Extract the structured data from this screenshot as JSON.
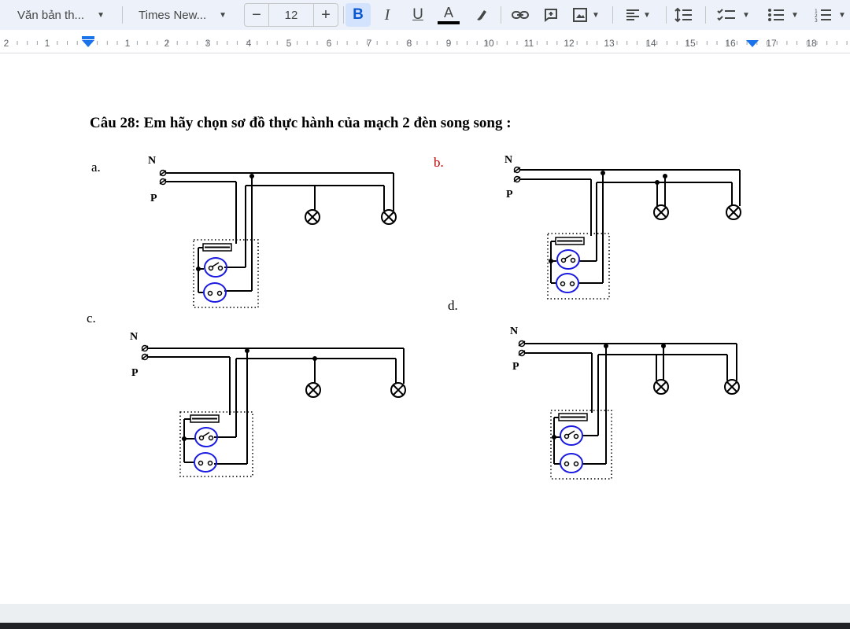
{
  "toolbar": {
    "style_select": "Văn bản th...",
    "font_select": "Times New...",
    "font_size": "12",
    "minus": "−",
    "plus": "+",
    "bold": "B",
    "italic": "I",
    "underline": "U",
    "text_color": "A",
    "text_color_value": "#000000"
  },
  "ruler": {
    "labels": [
      "2",
      "1",
      "1",
      "2",
      "3",
      "4",
      "5",
      "6",
      "7",
      "8",
      "9",
      "10",
      "11",
      "12",
      "13",
      "14",
      "15",
      "16",
      "17",
      "18"
    ],
    "marker_color": "#1a73e8"
  },
  "document": {
    "question": "Câu 28: Em hãy chọn sơ đồ thực hành của mạch 2 đèn  song song :",
    "options": [
      {
        "label": "a.",
        "color": "#000000"
      },
      {
        "label": "b.",
        "color": "#c00000"
      },
      {
        "label": "c.",
        "color": "#000000"
      },
      {
        "label": "d.",
        "color": "#000000"
      }
    ],
    "terminal_n": "N",
    "terminal_p": "P"
  },
  "colors": {
    "toolbar_bg": "#edf2fa",
    "active_button": "#d3e3fd",
    "active_icon": "#0b57d0",
    "socket_outline": "#1a1ae0",
    "wire": "#000000"
  }
}
